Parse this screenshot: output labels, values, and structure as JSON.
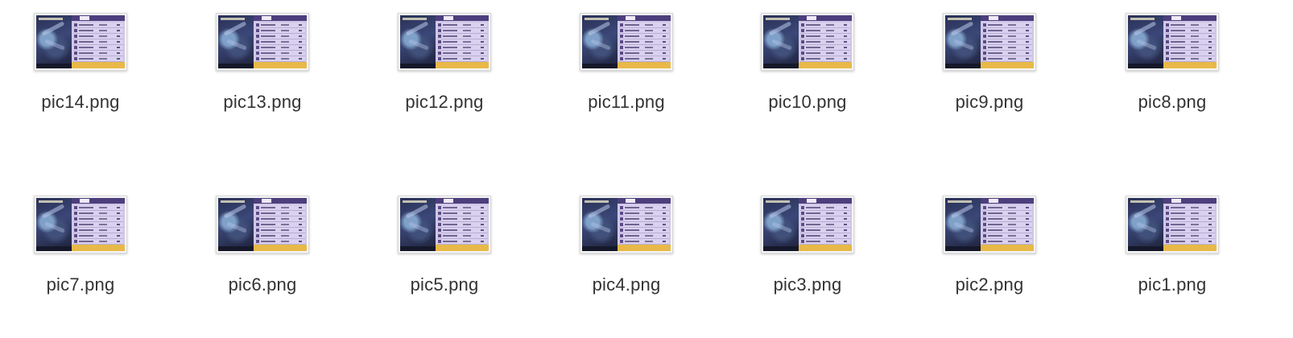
{
  "files": [
    {
      "name": "pic14.png",
      "icon": "png-thumbnail"
    },
    {
      "name": "pic13.png",
      "icon": "png-thumbnail"
    },
    {
      "name": "pic12.png",
      "icon": "png-thumbnail"
    },
    {
      "name": "pic11.png",
      "icon": "png-thumbnail"
    },
    {
      "name": "pic10.png",
      "icon": "png-thumbnail"
    },
    {
      "name": "pic9.png",
      "icon": "png-thumbnail"
    },
    {
      "name": "pic8.png",
      "icon": "png-thumbnail"
    },
    {
      "name": "pic7.png",
      "icon": "png-thumbnail"
    },
    {
      "name": "pic6.png",
      "icon": "png-thumbnail"
    },
    {
      "name": "pic5.png",
      "icon": "png-thumbnail"
    },
    {
      "name": "pic4.png",
      "icon": "png-thumbnail"
    },
    {
      "name": "pic3.png",
      "icon": "png-thumbnail"
    },
    {
      "name": "pic2.png",
      "icon": "png-thumbnail"
    },
    {
      "name": "pic1.png",
      "icon": "png-thumbnail"
    }
  ],
  "colors": {
    "background": "#ffffff",
    "label": "#333333",
    "thumbnail_panel": "#cfc6e6",
    "thumbnail_header": "#4d3f7d",
    "thumbnail_footer": "#e8b948",
    "thumbnail_art": "#2a3156"
  }
}
